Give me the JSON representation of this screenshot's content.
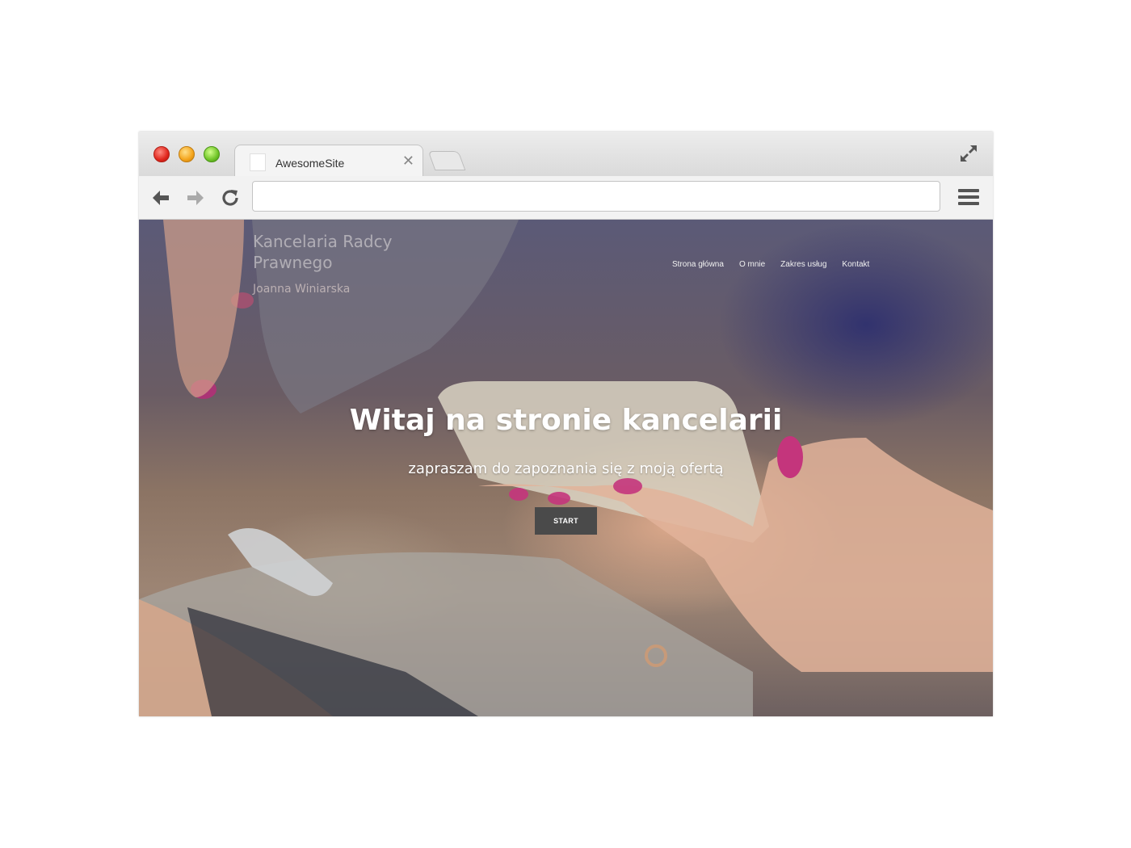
{
  "browser": {
    "tab_title": "AwesomeSite",
    "tab_close_glyph": "✕",
    "url": "",
    "icons": [
      "close-window-icon",
      "minimize-window-icon",
      "maximize-window-icon",
      "expand-icon",
      "back-arrow-icon",
      "forward-arrow-icon",
      "reload-icon",
      "menu-icon"
    ]
  },
  "site": {
    "brand_title": "Kancelaria Radcy Prawnego",
    "brand_subtitle": "Joanna Winiarska",
    "nav": [
      "Strona główna",
      "O mnie",
      "Zakres usług",
      "Kontakt"
    ],
    "hero_title": "Witaj na stronie kancelarii",
    "hero_subtitle": "zapraszam do zapoznania się z moją ofertą",
    "cta_label": "START"
  }
}
